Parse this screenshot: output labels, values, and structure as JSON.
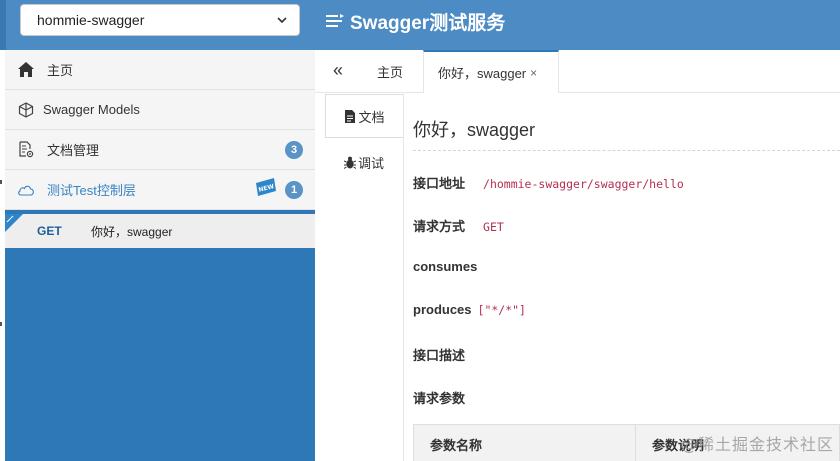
{
  "header": {
    "group_select": "hommie-swagger",
    "app_title": "Swagger测试服务"
  },
  "sidebar": {
    "items": [
      {
        "label": "主页",
        "icon": "home-icon"
      },
      {
        "label": "Swagger Models",
        "icon": "cube-icon"
      },
      {
        "label": "文档管理",
        "icon": "doc-settings-icon",
        "badge": "3"
      },
      {
        "label": "测试Test控制层",
        "icon": "cloud-icon",
        "badge": "1",
        "tag": "NEW"
      }
    ],
    "api": {
      "method": "GET",
      "name": "你好，swagger"
    }
  },
  "tabs": {
    "collapse": "«",
    "home": "主页",
    "current": "你好，swagger",
    "close": "×"
  },
  "doc_tabs": {
    "doc": "文档",
    "debug": "调试"
  },
  "content": {
    "title": "你好，swagger",
    "fields": [
      {
        "label": "接口地址",
        "value": "/hommie-swagger/swagger/hello"
      },
      {
        "label": "请求方式",
        "value": "GET"
      },
      {
        "label": "consumes",
        "value": ""
      },
      {
        "label": "produces",
        "value": "[\"*/*\"]"
      },
      {
        "label": "接口描述",
        "value": ""
      },
      {
        "label": "请求参数",
        "value": ""
      }
    ],
    "params_headers": [
      "参数名称",
      "参数说明"
    ]
  },
  "watermark": "@稀土掘金技术社区",
  "colors": {
    "header": "#4c8bc4",
    "sidebar": "#2f78b8",
    "accent": "#3a83c4",
    "code": "#b52f52"
  }
}
